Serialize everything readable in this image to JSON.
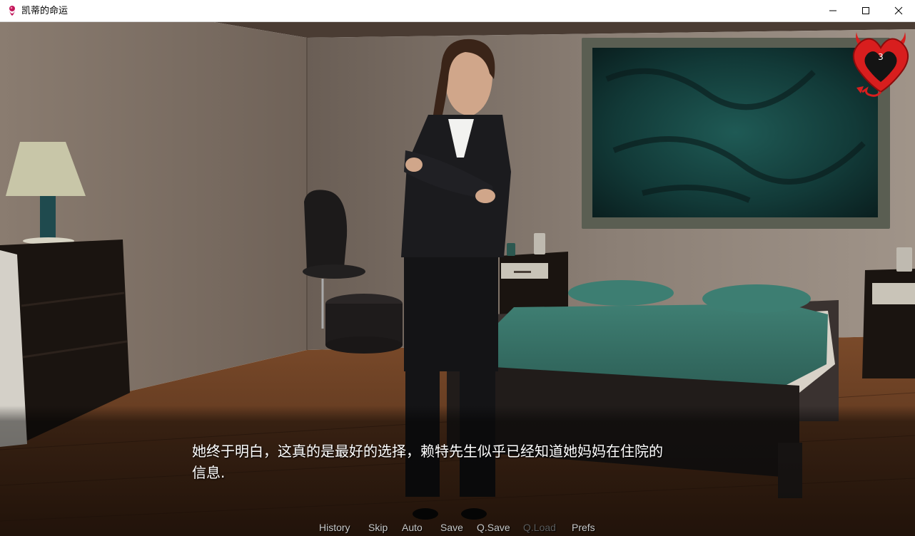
{
  "window": {
    "title": "凯蒂的命运",
    "controls": [
      "minimize",
      "maximize",
      "close"
    ]
  },
  "hud": {
    "heart_icon": "devil-heart-icon",
    "heart_count": "3"
  },
  "dialogue": {
    "line1": "她终于明白，这真的是最好的选择，赖特先生似乎已经知道她妈妈在住院的",
    "line2": "信息."
  },
  "quick_menu": {
    "history": "History",
    "skip": "Skip",
    "auto": "Auto",
    "save": "Save",
    "qsave": "Q.Save",
    "qload": "Q.Load",
    "prefs": "Prefs"
  },
  "colors": {
    "accent_red": "#d81e1e",
    "menu_text": "#c8c8c8",
    "menu_disabled": "#5c5c5c"
  }
}
